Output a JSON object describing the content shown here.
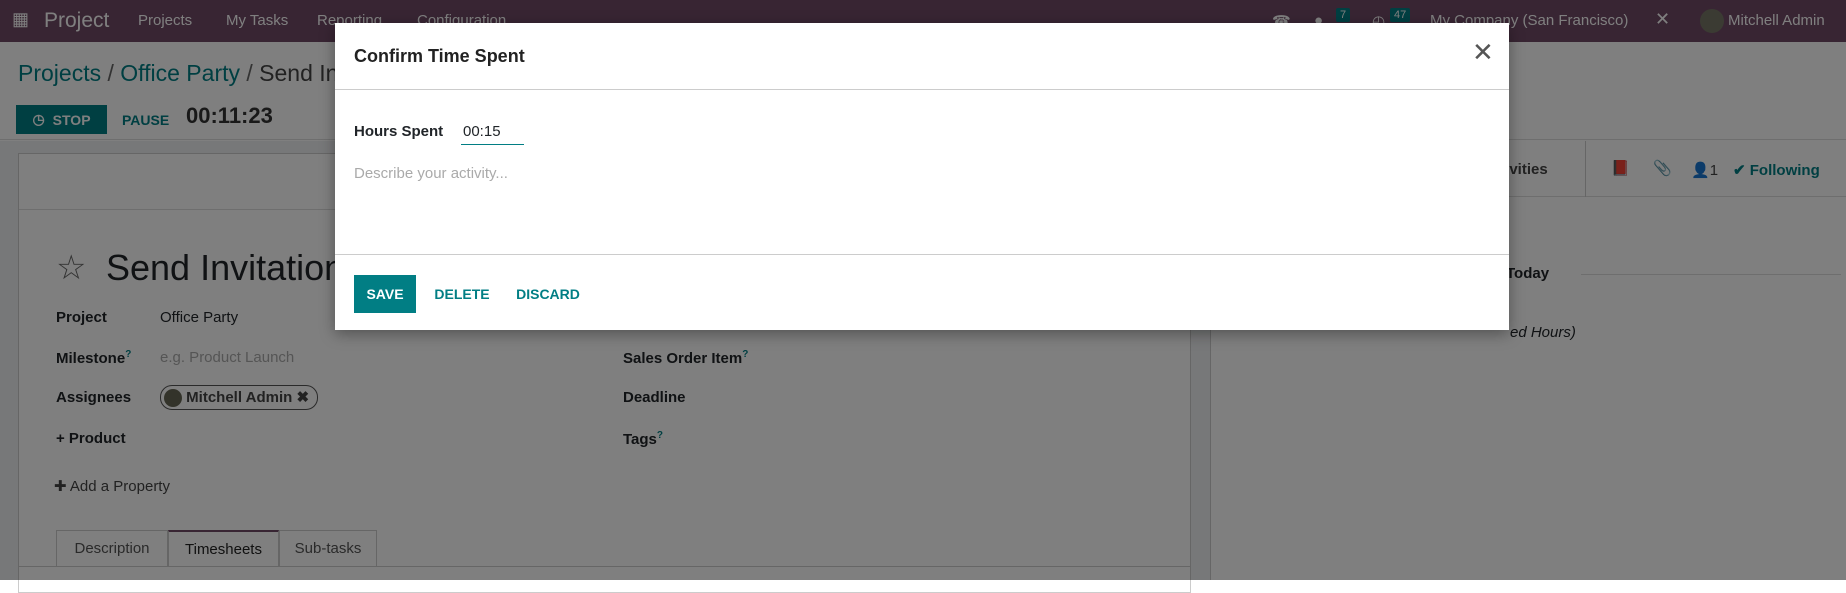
{
  "topbar": {
    "app_name": "Project",
    "menu": [
      "Projects",
      "My Tasks",
      "Reporting",
      "Configuration"
    ],
    "messages_count": "7",
    "activities_count": "47",
    "company": "My Company (San Francisco)",
    "user": "Mitchell Admin"
  },
  "breadcrumb": {
    "items": [
      "Projects",
      "Office Party",
      "Send Invitations"
    ],
    "separator": "/"
  },
  "timer": {
    "stop_label": "STOP",
    "pause_label": "PAUSE",
    "elapsed": "00:11:23"
  },
  "chatter": {
    "activities_label": "Activities",
    "followers_count": "1",
    "following_label": "Following",
    "date_separator": "Today",
    "message_fragment": "ed Hours)"
  },
  "task": {
    "title": "Send Invitations",
    "fields_left": [
      {
        "label": "Project",
        "value": "Office Party"
      },
      {
        "label": "Milestone",
        "placeholder": "e.g. Product Launch"
      },
      {
        "label": "Assignees",
        "value": "Mitchell Admin"
      },
      {
        "label": "+ Product"
      }
    ],
    "fields_right": [
      {
        "label": "Sales Order Item"
      },
      {
        "label": "Deadline"
      },
      {
        "label": "Tags"
      }
    ],
    "add_property": "Add a Property",
    "tabs": [
      "Description",
      "Timesheets",
      "Sub-tasks"
    ],
    "active_tab": "Timesheets"
  },
  "modal": {
    "title": "Confirm Time Spent",
    "hours_label": "Hours Spent",
    "hours_value": "00:15",
    "description_placeholder": "Describe your activity...",
    "save": "SAVE",
    "delete": "DELETE",
    "discard": "DISCARD"
  },
  "colors": {
    "brand": "#714B67",
    "accent": "#017e84"
  }
}
